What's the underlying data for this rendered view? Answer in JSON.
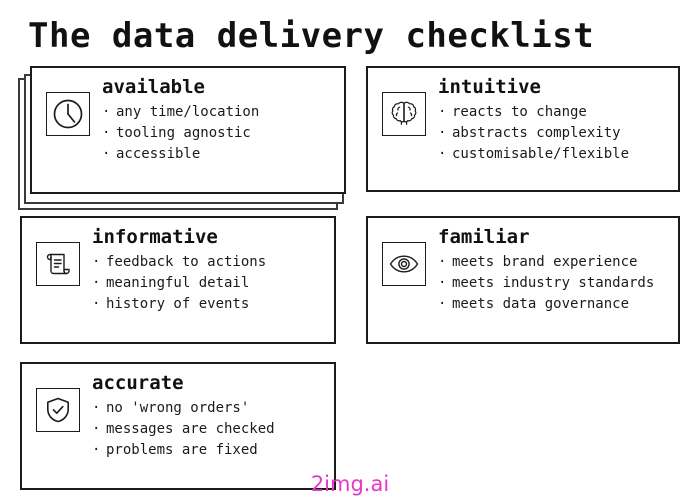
{
  "page": {
    "title": "The data delivery checklist",
    "background_color": "#ffffff",
    "text_color": "#111111",
    "border_color": "#1b1b1b"
  },
  "watermark": {
    "text": "2img.ai",
    "color": "#e637c8"
  },
  "cards": [
    {
      "id": "available",
      "heading": "available",
      "icon": "clock-icon",
      "stacked": true,
      "bullets": [
        "any time/location",
        "tooling agnostic",
        "accessible"
      ]
    },
    {
      "id": "intuitive",
      "heading": "intuitive",
      "icon": "brain-icon",
      "stacked": false,
      "bullets": [
        "reacts to change",
        "abstracts complexity",
        "customisable/flexible"
      ]
    },
    {
      "id": "informative",
      "heading": "informative",
      "icon": "scroll-icon",
      "stacked": false,
      "bullets": [
        "feedback to actions",
        "meaningful detail",
        "history of events"
      ]
    },
    {
      "id": "familiar",
      "heading": "familiar",
      "icon": "eye-icon",
      "stacked": false,
      "bullets": [
        "meets brand experience",
        "meets industry standards",
        "meets data governance"
      ]
    },
    {
      "id": "accurate",
      "heading": "accurate",
      "icon": "shield-check-icon",
      "stacked": false,
      "bullets": [
        "no 'wrong orders'",
        "messages are checked",
        "problems are fixed"
      ]
    }
  ],
  "bullet_glyph": "·"
}
